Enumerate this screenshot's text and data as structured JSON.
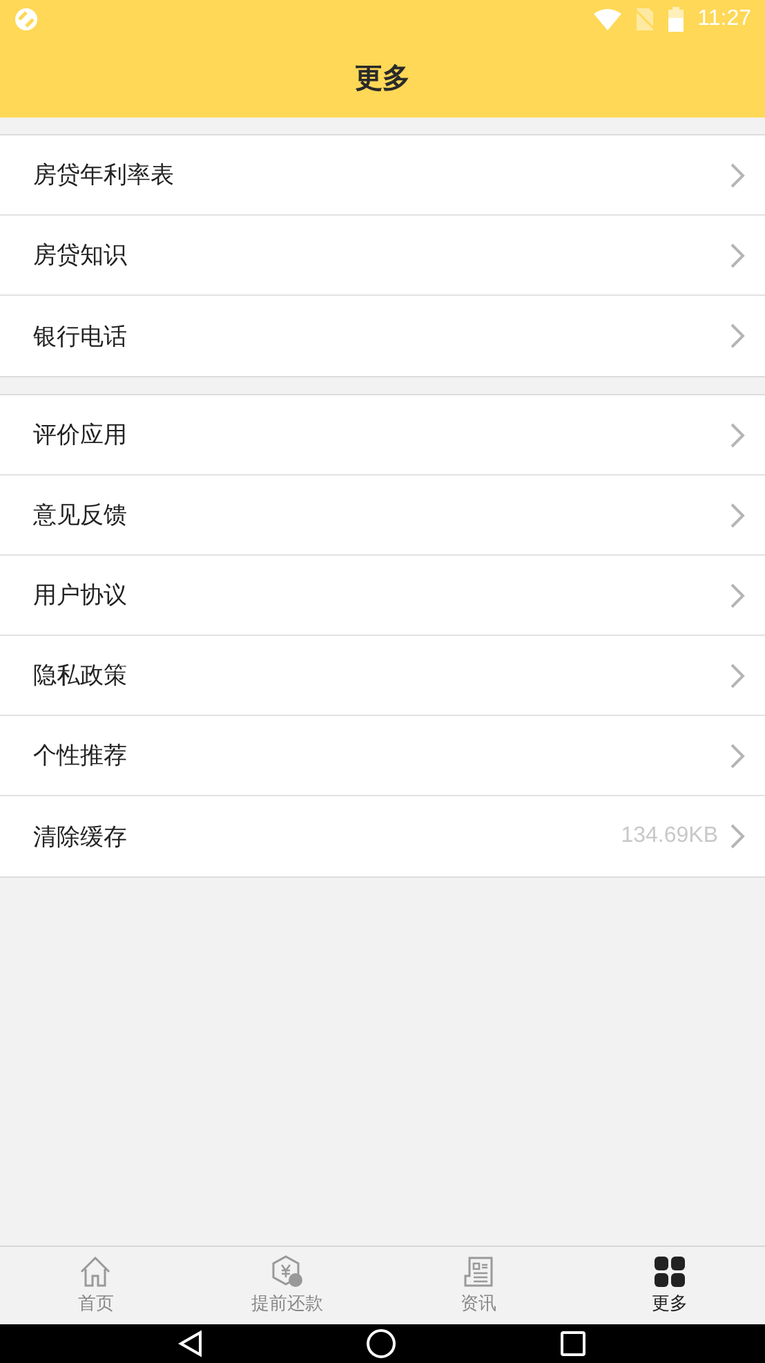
{
  "status_bar": {
    "time": "11:27"
  },
  "header": {
    "title": "更多"
  },
  "groups": [
    {
      "items": [
        {
          "label": "房贷年利率表"
        },
        {
          "label": "房贷知识"
        },
        {
          "label": "银行电话"
        }
      ]
    },
    {
      "items": [
        {
          "label": "评价应用"
        },
        {
          "label": "意见反馈"
        },
        {
          "label": "用户协议"
        },
        {
          "label": "隐私政策"
        },
        {
          "label": "个性推荐"
        },
        {
          "label": "清除缓存",
          "value": "134.69KB"
        }
      ]
    }
  ],
  "tabs": [
    {
      "label": "首页",
      "kind": "home",
      "selected": false
    },
    {
      "label": "提前还款",
      "kind": "repay",
      "selected": false
    },
    {
      "label": "资讯",
      "kind": "news",
      "selected": false
    },
    {
      "label": "更多",
      "kind": "grid",
      "selected": true
    }
  ]
}
